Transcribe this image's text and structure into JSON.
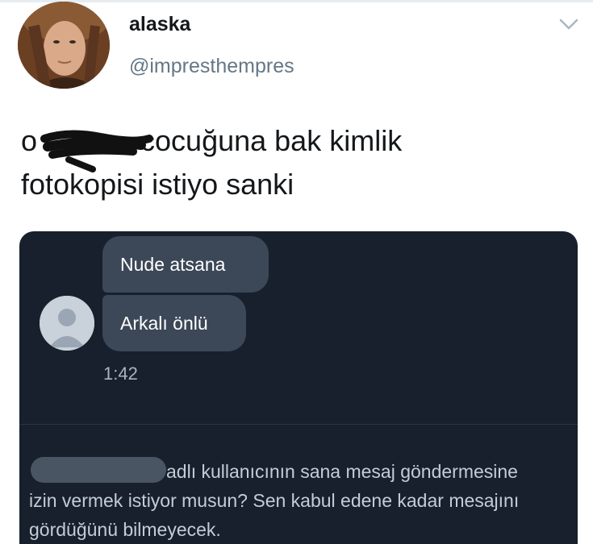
{
  "tweet": {
    "display_name": "alaska",
    "handle": "@impresthempres",
    "text_start": "o",
    "text_line1_rest": "cocuğuna bak kimlik",
    "text_line2": "fotokopisi istiyo sanki",
    "menu_icon": "chevron-down-icon"
  },
  "dm": {
    "messages": [
      {
        "text": "Nude atsana"
      },
      {
        "text": "Arkalı önlü"
      }
    ],
    "timestamp": "1:42",
    "request_text": "adlı kullanıcının sana mesaj göndermesine izin vermek istiyor musun? Sen kabul edene kadar mesajını gördüğünü bilmeyecek."
  },
  "colors": {
    "dm_background": "#17202c",
    "bubble": "#3c4757",
    "handle_gray": "#657786"
  }
}
